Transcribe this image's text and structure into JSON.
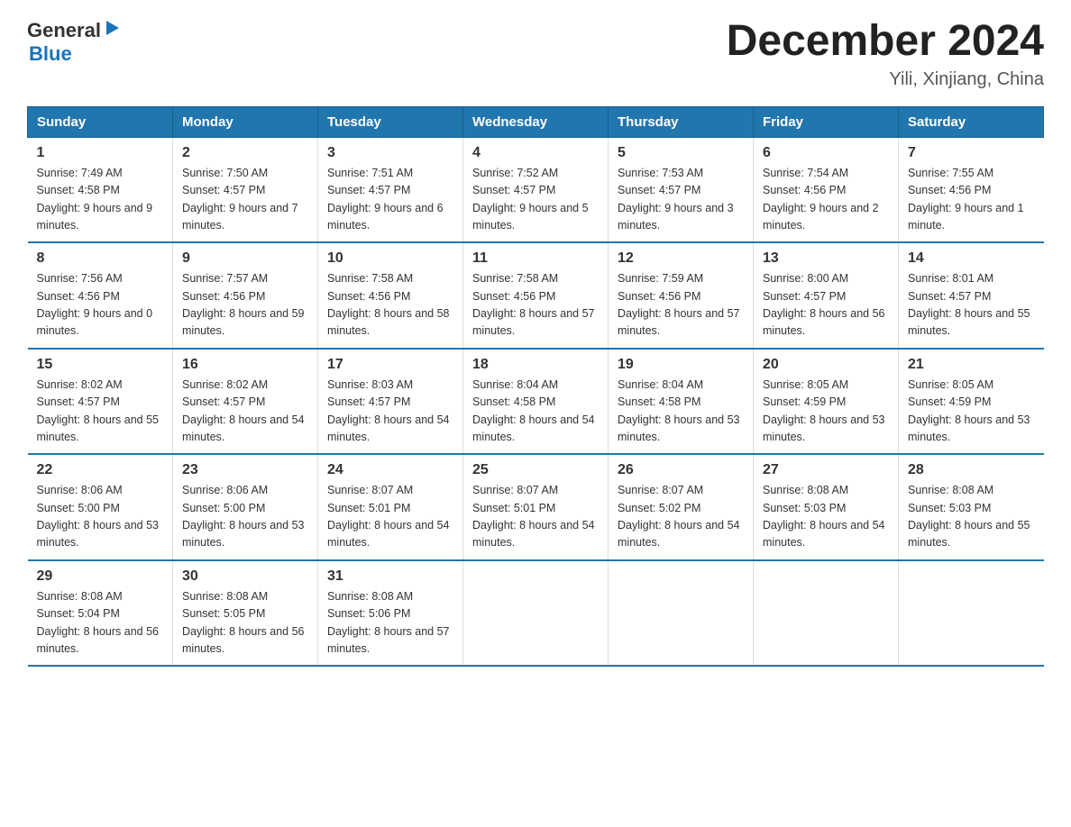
{
  "header": {
    "logo_general": "General",
    "logo_blue": "Blue",
    "title": "December 2024",
    "subtitle": "Yili, Xinjiang, China"
  },
  "weekdays": [
    "Sunday",
    "Monday",
    "Tuesday",
    "Wednesday",
    "Thursday",
    "Friday",
    "Saturday"
  ],
  "weeks": [
    [
      {
        "day": "1",
        "sunrise": "7:49 AM",
        "sunset": "4:58 PM",
        "daylight": "9 hours and 9 minutes."
      },
      {
        "day": "2",
        "sunrise": "7:50 AM",
        "sunset": "4:57 PM",
        "daylight": "9 hours and 7 minutes."
      },
      {
        "day": "3",
        "sunrise": "7:51 AM",
        "sunset": "4:57 PM",
        "daylight": "9 hours and 6 minutes."
      },
      {
        "day": "4",
        "sunrise": "7:52 AM",
        "sunset": "4:57 PM",
        "daylight": "9 hours and 5 minutes."
      },
      {
        "day": "5",
        "sunrise": "7:53 AM",
        "sunset": "4:57 PM",
        "daylight": "9 hours and 3 minutes."
      },
      {
        "day": "6",
        "sunrise": "7:54 AM",
        "sunset": "4:56 PM",
        "daylight": "9 hours and 2 minutes."
      },
      {
        "day": "7",
        "sunrise": "7:55 AM",
        "sunset": "4:56 PM",
        "daylight": "9 hours and 1 minute."
      }
    ],
    [
      {
        "day": "8",
        "sunrise": "7:56 AM",
        "sunset": "4:56 PM",
        "daylight": "9 hours and 0 minutes."
      },
      {
        "day": "9",
        "sunrise": "7:57 AM",
        "sunset": "4:56 PM",
        "daylight": "8 hours and 59 minutes."
      },
      {
        "day": "10",
        "sunrise": "7:58 AM",
        "sunset": "4:56 PM",
        "daylight": "8 hours and 58 minutes."
      },
      {
        "day": "11",
        "sunrise": "7:58 AM",
        "sunset": "4:56 PM",
        "daylight": "8 hours and 57 minutes."
      },
      {
        "day": "12",
        "sunrise": "7:59 AM",
        "sunset": "4:56 PM",
        "daylight": "8 hours and 57 minutes."
      },
      {
        "day": "13",
        "sunrise": "8:00 AM",
        "sunset": "4:57 PM",
        "daylight": "8 hours and 56 minutes."
      },
      {
        "day": "14",
        "sunrise": "8:01 AM",
        "sunset": "4:57 PM",
        "daylight": "8 hours and 55 minutes."
      }
    ],
    [
      {
        "day": "15",
        "sunrise": "8:02 AM",
        "sunset": "4:57 PM",
        "daylight": "8 hours and 55 minutes."
      },
      {
        "day": "16",
        "sunrise": "8:02 AM",
        "sunset": "4:57 PM",
        "daylight": "8 hours and 54 minutes."
      },
      {
        "day": "17",
        "sunrise": "8:03 AM",
        "sunset": "4:57 PM",
        "daylight": "8 hours and 54 minutes."
      },
      {
        "day": "18",
        "sunrise": "8:04 AM",
        "sunset": "4:58 PM",
        "daylight": "8 hours and 54 minutes."
      },
      {
        "day": "19",
        "sunrise": "8:04 AM",
        "sunset": "4:58 PM",
        "daylight": "8 hours and 53 minutes."
      },
      {
        "day": "20",
        "sunrise": "8:05 AM",
        "sunset": "4:59 PM",
        "daylight": "8 hours and 53 minutes."
      },
      {
        "day": "21",
        "sunrise": "8:05 AM",
        "sunset": "4:59 PM",
        "daylight": "8 hours and 53 minutes."
      }
    ],
    [
      {
        "day": "22",
        "sunrise": "8:06 AM",
        "sunset": "5:00 PM",
        "daylight": "8 hours and 53 minutes."
      },
      {
        "day": "23",
        "sunrise": "8:06 AM",
        "sunset": "5:00 PM",
        "daylight": "8 hours and 53 minutes."
      },
      {
        "day": "24",
        "sunrise": "8:07 AM",
        "sunset": "5:01 PM",
        "daylight": "8 hours and 54 minutes."
      },
      {
        "day": "25",
        "sunrise": "8:07 AM",
        "sunset": "5:01 PM",
        "daylight": "8 hours and 54 minutes."
      },
      {
        "day": "26",
        "sunrise": "8:07 AM",
        "sunset": "5:02 PM",
        "daylight": "8 hours and 54 minutes."
      },
      {
        "day": "27",
        "sunrise": "8:08 AM",
        "sunset": "5:03 PM",
        "daylight": "8 hours and 54 minutes."
      },
      {
        "day": "28",
        "sunrise": "8:08 AM",
        "sunset": "5:03 PM",
        "daylight": "8 hours and 55 minutes."
      }
    ],
    [
      {
        "day": "29",
        "sunrise": "8:08 AM",
        "sunset": "5:04 PM",
        "daylight": "8 hours and 56 minutes."
      },
      {
        "day": "30",
        "sunrise": "8:08 AM",
        "sunset": "5:05 PM",
        "daylight": "8 hours and 56 minutes."
      },
      {
        "day": "31",
        "sunrise": "8:08 AM",
        "sunset": "5:06 PM",
        "daylight": "8 hours and 57 minutes."
      },
      null,
      null,
      null,
      null
    ]
  ],
  "labels": {
    "sunrise": "Sunrise:",
    "sunset": "Sunset:",
    "daylight": "Daylight:"
  }
}
